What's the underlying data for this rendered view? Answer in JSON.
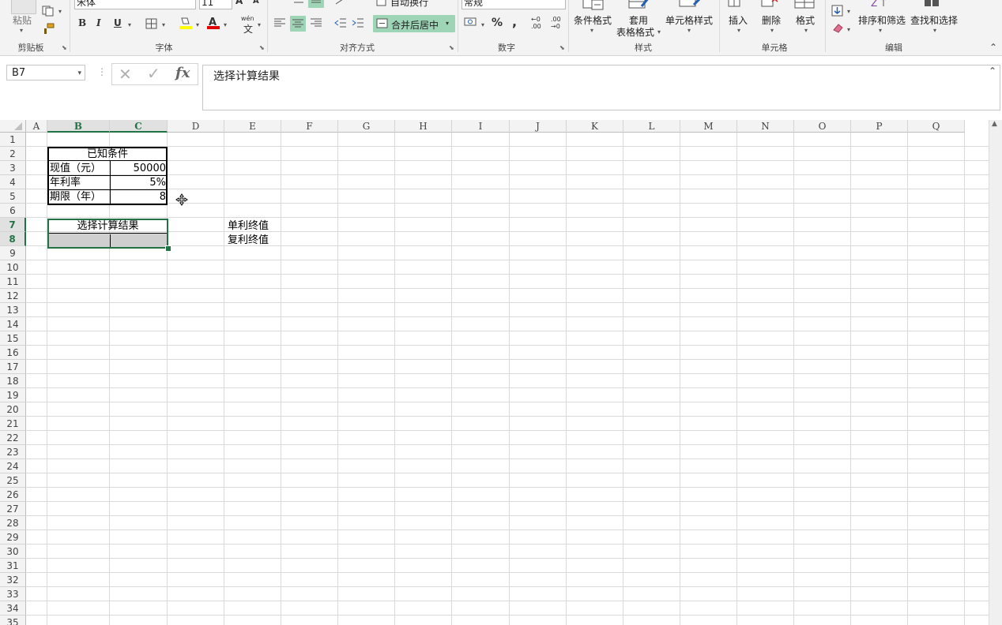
{
  "ribbon": {
    "clipboard": {
      "paste_label": "粘贴",
      "group_label": "剪贴板"
    },
    "font": {
      "font_name": "宋体",
      "font_size": "11",
      "bold": "B",
      "italic": "I",
      "underline": "U",
      "grow": "A",
      "shrink": "A",
      "phonetic_top": "wén",
      "phonetic_bottom": "文",
      "group_label": "字体"
    },
    "alignment": {
      "wrap_label": "自动换行",
      "merge_label": "合并后居中",
      "group_label": "对齐方式"
    },
    "number": {
      "format_value": "常规",
      "percent": "%",
      "comma": ",",
      "inc_decimal_top": "←0",
      "inc_decimal_bottom": ".00",
      "dec_decimal_top": ".00",
      "dec_decimal_bottom": "→0",
      "group_label": "数字"
    },
    "styles": {
      "conditional_label": "条件格式",
      "table_label_1": "套用",
      "table_label_2": "表格格式",
      "cell_styles_label": "单元格样式",
      "group_label": "样式"
    },
    "cells": {
      "insert_label": "插入",
      "delete_label": "删除",
      "format_label": "格式",
      "group_label": "单元格"
    },
    "editing": {
      "sort_label": "排序和筛选",
      "find_label": "查找和选择",
      "group_label": "编辑"
    },
    "colors": {
      "accent": "#217346",
      "merge_bg": "#9fd5b7",
      "fill_yellow": "#ffff00",
      "font_red": "#e00000"
    }
  },
  "formula_bar": {
    "name_box": "B7",
    "cancel_icon": "✕",
    "enter_icon": "✓",
    "fx": "fx",
    "content": "选择计算结果"
  },
  "columns": [
    "A",
    "B",
    "C",
    "D",
    "E",
    "F",
    "G",
    "H",
    "I",
    "J",
    "K",
    "L",
    "M",
    "N",
    "O",
    "P",
    "Q"
  ],
  "rows": [
    "1",
    "2",
    "3",
    "4",
    "5",
    "6",
    "7",
    "8",
    "9",
    "10",
    "11",
    "12",
    "13",
    "14",
    "15",
    "16",
    "17",
    "18",
    "19",
    "20",
    "21",
    "22",
    "23",
    "24",
    "25",
    "26",
    "27",
    "28",
    "29",
    "30",
    "31",
    "32",
    "33",
    "34",
    "35"
  ],
  "cells": {
    "B2": "已知条件",
    "B3": "现值（元）",
    "C3": "50000",
    "B4": "年利率",
    "C4": "5%",
    "B5": "期限（年）",
    "C5": "8",
    "B7": "选择计算结果",
    "E7": "单利终值",
    "E8": "复利终值"
  },
  "selection": {
    "active_cell": "B7",
    "selected_columns": [
      "B",
      "C"
    ],
    "selected_rows": [
      "7",
      "8"
    ]
  }
}
